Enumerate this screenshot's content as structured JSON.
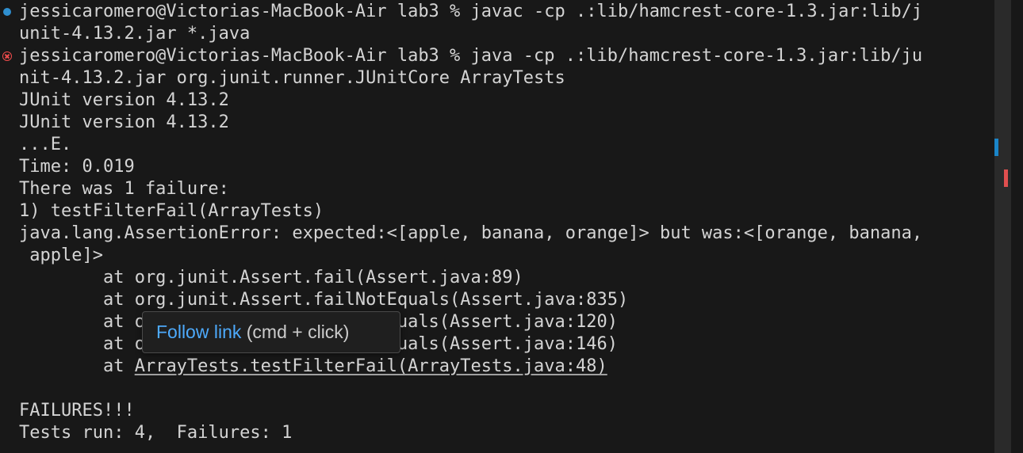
{
  "terminal": {
    "lines": [
      {
        "text": "jessicaromero@Victorias-MacBook-Air lab3 % javac -cp .:lib/hamcrest-core-1.3.jar:lib/j",
        "decoration": "success"
      },
      {
        "text": "unit-4.13.2.jar *.java"
      },
      {
        "text": "jessicaromero@Victorias-MacBook-Air lab3 % java -cp .:lib/hamcrest-core-1.3.jar:lib/ju",
        "decoration": "error"
      },
      {
        "text": "nit-4.13.2.jar org.junit.runner.JUnitCore ArrayTests"
      },
      {
        "text": "JUnit version 4.13.2"
      },
      {
        "text": "JUnit version 4.13.2"
      },
      {
        "text": "...E."
      },
      {
        "text": "Time: 0.019"
      },
      {
        "text": "There was 1 failure:"
      },
      {
        "text": "1) testFilterFail(ArrayTests)"
      },
      {
        "text": "java.lang.AssertionError: expected:<[apple, banana, orange]> but was:<[orange, banana,"
      },
      {
        "text": " apple]>"
      },
      {
        "text": "        at org.junit.Assert.fail(Assert.java:89)"
      },
      {
        "text": "        at org.junit.Assert.failNotEquals(Assert.java:835)"
      },
      {
        "text": "        at org.junit.Assert.assertEquals(Assert.java:120)"
      },
      {
        "text": "        at org.junit.Assert.assertEquals(Assert.java:146)"
      },
      {
        "text": "        at ",
        "link": "ArrayTests.testFilterFail(ArrayTests.java:48)"
      },
      {
        "text": ""
      },
      {
        "text": "FAILURES!!!"
      },
      {
        "text": "Tests run: 4,  Failures: 1"
      }
    ]
  },
  "tooltip": {
    "action": "Follow link",
    "hint": " (cmd + click)"
  },
  "colors": {
    "background": "#181818",
    "text": "#d4d4d4",
    "success": "#2f8fd0",
    "error": "#f14c4c",
    "link": "#4daafc",
    "scroll_mark_blue": "#1a85c8",
    "scroll_mark_red": "#e04f4f"
  }
}
